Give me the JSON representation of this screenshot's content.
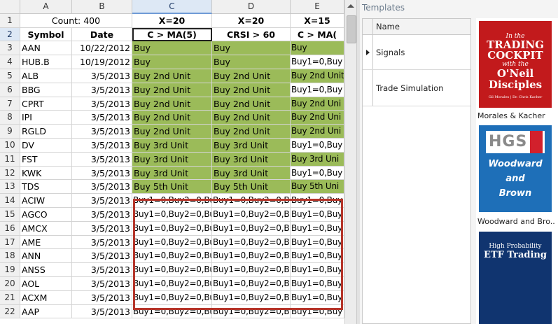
{
  "columns": [
    "A",
    "B",
    "C",
    "D",
    "E"
  ],
  "row1": {
    "count": "Count: 400",
    "c": "X=20",
    "d": "X=20",
    "e": "X=15"
  },
  "row2": {
    "a": "Symbol",
    "b": "Date",
    "c": "C > MA(5)",
    "d": "CRSI > 60",
    "e": "C > MA("
  },
  "rows": [
    {
      "num": "3",
      "symbol": "AAN",
      "date": "10/22/2012",
      "c": "Buy",
      "d": "Buy",
      "e": "Buy"
    },
    {
      "num": "4",
      "symbol": "HUB.B",
      "date": "10/19/2012",
      "c": "Buy",
      "d": "Buy",
      "e": "Buy1=0,Buy"
    },
    {
      "num": "5",
      "symbol": "ALB",
      "date": "3/5/2013",
      "c": "Buy 2nd Unit",
      "d": "Buy 2nd Unit",
      "e": "Buy 2nd Unit"
    },
    {
      "num": "6",
      "symbol": "BBG",
      "date": "3/5/2013",
      "c": "Buy 2nd Unit",
      "d": "Buy 2nd Unit",
      "e": "Buy1=0,Buy"
    },
    {
      "num": "7",
      "symbol": "CPRT",
      "date": "3/5/2013",
      "c": "Buy 2nd Unit",
      "d": "Buy 2nd Unit",
      "e": "Buy 2nd Uni"
    },
    {
      "num": "8",
      "symbol": "IPI",
      "date": "3/5/2013",
      "c": "Buy 2nd Unit",
      "d": "Buy 2nd Unit",
      "e": "Buy 2nd Uni"
    },
    {
      "num": "9",
      "symbol": "RGLD",
      "date": "3/5/2013",
      "c": "Buy 2nd Unit",
      "d": "Buy 2nd Unit",
      "e": "Buy 2nd Uni"
    },
    {
      "num": "10",
      "symbol": "DV",
      "date": "3/5/2013",
      "c": "Buy 3rd Unit",
      "d": "Buy 3rd Unit",
      "e": "Buy1=0,Buy"
    },
    {
      "num": "11",
      "symbol": "FST",
      "date": "3/5/2013",
      "c": "Buy 3rd Unit",
      "d": "Buy 3rd Unit",
      "e": "Buy 3rd Uni"
    },
    {
      "num": "12",
      "symbol": "KWK",
      "date": "3/5/2013",
      "c": "Buy 3rd Unit",
      "d": "Buy 3rd Unit",
      "e": "Buy1=0,Buy"
    },
    {
      "num": "13",
      "symbol": "TDS",
      "date": "3/5/2013",
      "c": "Buy 5th Unit",
      "d": "Buy 5th Unit",
      "e": "Buy 5th Uni"
    },
    {
      "num": "14",
      "symbol": "ACIW",
      "date": "3/5/2013",
      "c": "Buy1=0,Buy2=0,Bu",
      "d": "Buy1=0,Buy2=0,Bu",
      "e": "Buy1=0,Buy"
    },
    {
      "num": "15",
      "symbol": "AGCO",
      "date": "3/5/2013",
      "c": "Buy1=0,Buy2=0,Bu",
      "d": "Buy1=0,Buy2=0,Bu",
      "e": "Buy1=0,Buy"
    },
    {
      "num": "16",
      "symbol": "AMCX",
      "date": "3/5/2013",
      "c": "Buy1=0,Buy2=0,Bu",
      "d": "Buy1=0,Buy2=0,Bu",
      "e": "Buy1=0,Buy"
    },
    {
      "num": "17",
      "symbol": "AME",
      "date": "3/5/2013",
      "c": "Buy1=0,Buy2=0,Bu",
      "d": "Buy1=0,Buy2=0,Bu",
      "e": "Buy1=0,Buy"
    },
    {
      "num": "18",
      "symbol": "ANN",
      "date": "3/5/2013",
      "c": "Buy1=0,Buy2=0,Bu",
      "d": "Buy1=0,Buy2=0,Bu",
      "e": "Buy1=0,Buy"
    },
    {
      "num": "19",
      "symbol": "ANSS",
      "date": "3/5/2013",
      "c": "Buy1=0,Buy2=0,Bu",
      "d": "Buy1=0,Buy2=0,Bu",
      "e": "Buy1=0,Buy"
    },
    {
      "num": "20",
      "symbol": "AOL",
      "date": "3/5/2013",
      "c": "Buy1=0,Buy2=0,Bu",
      "d": "Buy1=0,Buy2=0,Bu",
      "e": "Buy1=0,Buy"
    },
    {
      "num": "21",
      "symbol": "ACXM",
      "date": "3/5/2013",
      "c": "Buy1=0,Buy2=0,Bu",
      "d": "Buy1=0,Buy2=0,Bu",
      "e": "Buy1=0,Buy"
    },
    {
      "num": "22",
      "symbol": "AAP",
      "date": "3/5/2013",
      "c": "Buy1=0,Buy2=0,Bu",
      "d": "Buy1=0,Buy2=0,Bu",
      "e": "Buy1=0,Buy"
    }
  ],
  "greenRows": 11,
  "templates": {
    "title": "Templates",
    "column": "Name",
    "items": [
      "Signals",
      "Trade Simulation"
    ],
    "books": [
      {
        "caption": "Morales & Kacher",
        "line1": "In the",
        "line2": "TRADING",
        "line3": "COCKPIT",
        "line4": "with the",
        "line5": "O'Neil",
        "line6": "Disciples",
        "authors": "Gil Morales | Dr. Chris Kacher"
      },
      {
        "caption": "Woodward and Bro...",
        "logo": "HGS",
        "name1": "Woodward",
        "name2": "and",
        "name3": "Brown"
      },
      {
        "line1": "High Probability",
        "line2": "ETF Trading"
      }
    ]
  },
  "colors": {
    "green": "#9bbb59",
    "highlight": "#b5352a",
    "selectedHeader": "#dde8f5"
  }
}
